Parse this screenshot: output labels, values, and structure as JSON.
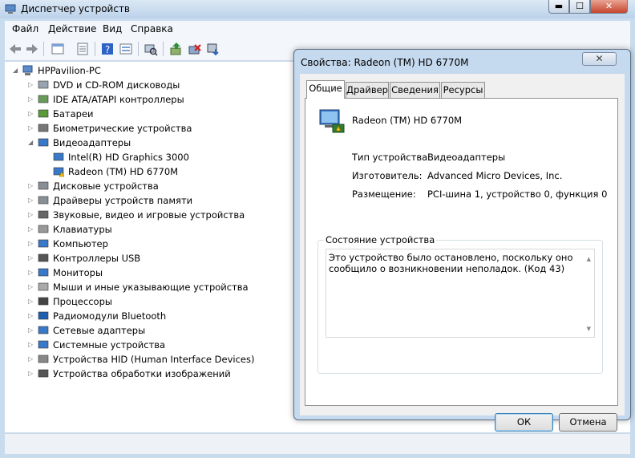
{
  "window": {
    "title": "Диспетчер устройств",
    "minimize": "▬",
    "maximize": "☐",
    "close": "✕"
  },
  "menu": {
    "items": [
      "Файл",
      "Действие",
      "Вид",
      "Справка"
    ]
  },
  "toolbar": {
    "icons": [
      "back-arrow-icon",
      "forward-arrow-icon",
      "properties-view-icon",
      "details-icon",
      "help-icon",
      "show-hidden-icon",
      "scan-hardware-icon",
      "update-driver-icon",
      "disable-device-icon",
      "uninstall-device-icon"
    ]
  },
  "tree": {
    "root": "HPPavilion-PC",
    "nodes": [
      {
        "label": "DVD и CD-ROM дисководы",
        "level": 1,
        "exp": "▷",
        "icon": "dvd-drive-icon"
      },
      {
        "label": "IDE ATA/ATAPI контроллеры",
        "level": 1,
        "exp": "▷",
        "icon": "ide-controller-icon"
      },
      {
        "label": "Батареи",
        "level": 1,
        "exp": "▷",
        "icon": "battery-icon"
      },
      {
        "label": "Биометрические устройства",
        "level": 1,
        "exp": "▷",
        "icon": "fingerprint-icon"
      },
      {
        "label": "Видеоадаптеры",
        "level": 1,
        "exp": "◢",
        "icon": "display-adapter-icon"
      },
      {
        "label": "Intel(R) HD Graphics 3000",
        "level": 2,
        "exp": "",
        "icon": "display-adapter-icon"
      },
      {
        "label": "Radeon (TM) HD 6770M",
        "level": 2,
        "exp": "",
        "icon": "display-adapter-warning-icon"
      },
      {
        "label": "Дисковые устройства",
        "level": 1,
        "exp": "▷",
        "icon": "disk-drive-icon"
      },
      {
        "label": "Драйверы устройств памяти",
        "level": 1,
        "exp": "▷",
        "icon": "storage-driver-icon"
      },
      {
        "label": "Звуковые, видео и игровые устройства",
        "level": 1,
        "exp": "▷",
        "icon": "speaker-icon"
      },
      {
        "label": "Клавиатуры",
        "level": 1,
        "exp": "▷",
        "icon": "keyboard-icon"
      },
      {
        "label": "Компьютер",
        "level": 1,
        "exp": "▷",
        "icon": "computer-icon"
      },
      {
        "label": "Контроллеры USB",
        "level": 1,
        "exp": "▷",
        "icon": "usb-icon"
      },
      {
        "label": "Мониторы",
        "level": 1,
        "exp": "▷",
        "icon": "monitor-icon"
      },
      {
        "label": "Мыши и иные указывающие устройства",
        "level": 1,
        "exp": "▷",
        "icon": "mouse-icon"
      },
      {
        "label": "Процессоры",
        "level": 1,
        "exp": "▷",
        "icon": "processor-icon"
      },
      {
        "label": "Радиомодули Bluetooth",
        "level": 1,
        "exp": "▷",
        "icon": "bluetooth-icon"
      },
      {
        "label": "Сетевые адаптеры",
        "level": 1,
        "exp": "▷",
        "icon": "network-adapter-icon"
      },
      {
        "label": "Системные устройства",
        "level": 1,
        "exp": "▷",
        "icon": "system-device-icon"
      },
      {
        "label": "Устройства HID (Human Interface Devices)",
        "level": 1,
        "exp": "▷",
        "icon": "hid-icon"
      },
      {
        "label": "Устройства обработки изображений",
        "level": 1,
        "exp": "▷",
        "icon": "camera-icon"
      }
    ]
  },
  "dialog": {
    "title": "Свойства: Radeon (TM) HD 6770M",
    "close": "✕",
    "tabs": [
      "Общие",
      "Драйвер",
      "Сведения",
      "Ресурсы"
    ],
    "device_name": "Radeon (TM) HD 6770M",
    "props": [
      {
        "label": "Тип устройства:",
        "value": "Видеоадаптеры"
      },
      {
        "label": "Изготовитель:",
        "value": "Advanced Micro Devices, Inc."
      },
      {
        "label": "Размещение:",
        "value": "PCI-шина 1, устройство 0, функция 0"
      }
    ],
    "status_title": "Состояние устройства",
    "status_text": "Это устройство было остановлено, поскольку оно сообщило о возникновении неполадок. (Код 43)",
    "ok": "ОК",
    "cancel": "Отмена"
  }
}
